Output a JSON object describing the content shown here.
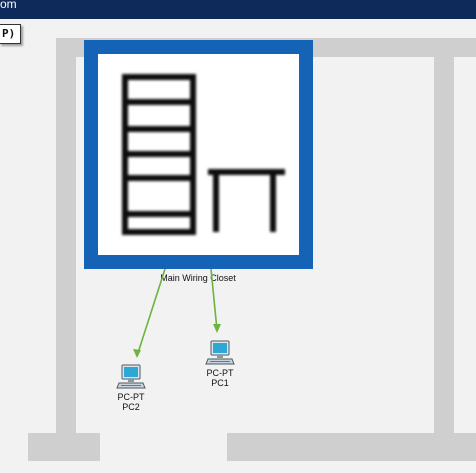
{
  "window": {
    "title_fragment": "om"
  },
  "tooltip": {
    "text": "P)"
  },
  "closet": {
    "label": "Main Wiring Closet",
    "icon": "rack-and-table-icon"
  },
  "devices": [
    {
      "type": "PC-PT",
      "name": "PC1",
      "icon": "pc-icon"
    },
    {
      "type": "PC-PT",
      "name": "PC2",
      "icon": "pc-icon"
    }
  ],
  "links": [
    {
      "from": "Main Wiring Closet",
      "to": "PC2",
      "color": "#6db33f"
    },
    {
      "from": "Main Wiring Closet",
      "to": "PC1",
      "color": "#6db33f"
    }
  ],
  "colors": {
    "title_bar": "#0d2a5a",
    "closet_frame": "#1463b6",
    "walls": "#cfcfcf",
    "link": "#6db33f",
    "pc_screen": "#2ca7d6"
  }
}
